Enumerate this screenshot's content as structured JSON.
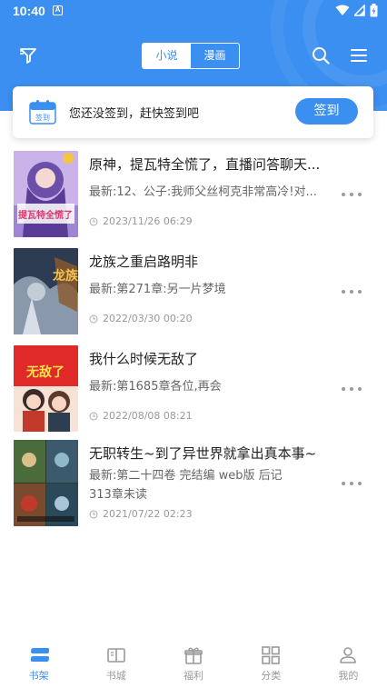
{
  "status_bar": {
    "time": "10:40",
    "notification_glyph": "A"
  },
  "header": {
    "tabs": [
      {
        "label": "小说",
        "active": true
      },
      {
        "label": "漫画",
        "active": false
      }
    ]
  },
  "signin": {
    "icon_label": "签到",
    "message": "您还没签到，赶快签到吧",
    "button_label": "签到"
  },
  "books": [
    {
      "title": "原神，提瓦特全慌了，直播问答聊天...",
      "latest": "最新:12、公子:我师父丝柯克非常高冷!对...",
      "updated": "2023/11/26 06:29",
      "cover_text": "提瓦特全慌了"
    },
    {
      "title": "龙族之重启路明非",
      "latest": "最新:第271章:另一片梦境",
      "updated": "2022/03/30 00:20",
      "cover_text": "龙族"
    },
    {
      "title": "我什么时候无敌了",
      "latest": "最新:第1685章各位,再会",
      "updated": "2022/08/08 08:21",
      "cover_text": "无敌了"
    },
    {
      "title": "无职转生~到了异世界就拿出真本事~",
      "latest": "最新:第二十四卷 完结编 web版 后记",
      "latest_extra": "313章未读",
      "updated": "2021/07/22 02:23",
      "cover_text": ""
    }
  ],
  "bottom_nav": [
    {
      "label": "书架",
      "icon": "bookshelf-icon",
      "active": true
    },
    {
      "label": "书城",
      "icon": "book-open-icon",
      "active": false
    },
    {
      "label": "福利",
      "icon": "gift-icon",
      "active": false
    },
    {
      "label": "分类",
      "icon": "grid-icon",
      "active": false
    },
    {
      "label": "我的",
      "icon": "user-icon",
      "active": false
    }
  ],
  "colors": {
    "accent": "#3b8ff0",
    "text": "#222222",
    "muted": "#999999"
  }
}
